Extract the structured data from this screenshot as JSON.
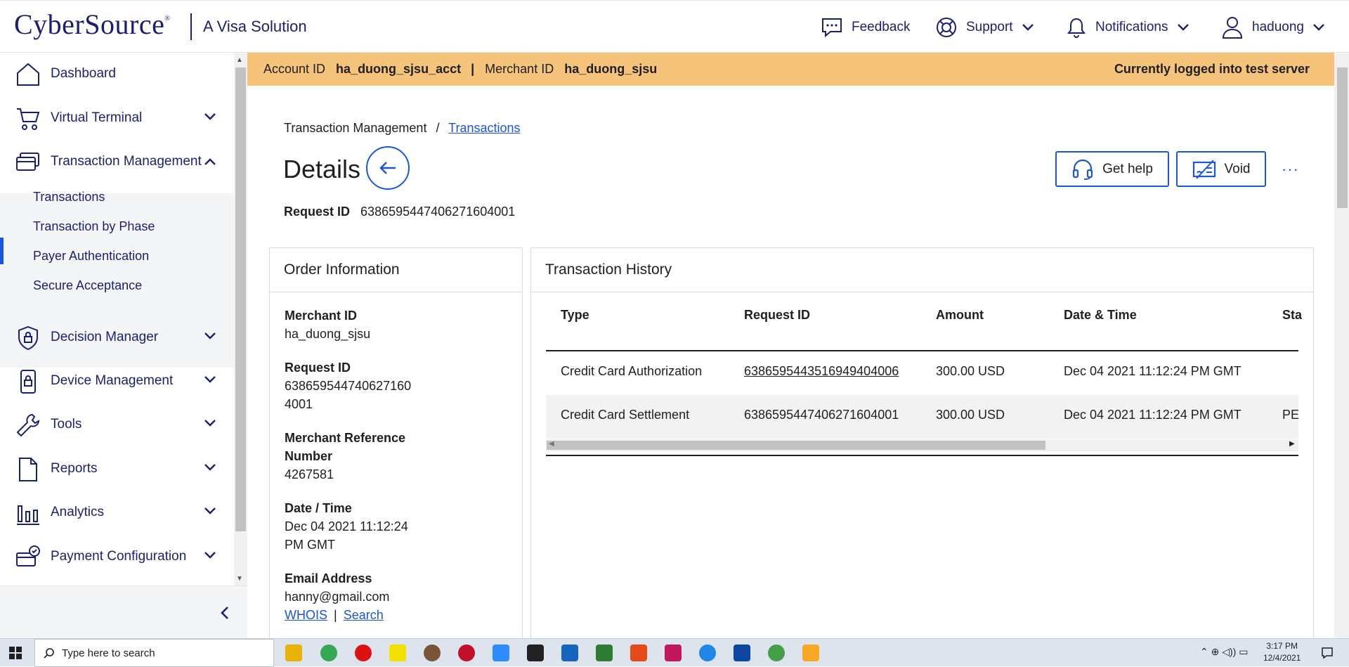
{
  "header": {
    "logo": "CyberSource",
    "logo_mark": "®",
    "logo_sub": "A Visa Solution",
    "feedback": "Feedback",
    "support": "Support",
    "notifications": "Notifications",
    "user": "haduong"
  },
  "sidebar": {
    "items": [
      {
        "label": "Dashboard",
        "icon": "home-icon"
      },
      {
        "label": "Virtual Terminal",
        "icon": "cart-icon"
      },
      {
        "label": "Transaction Management",
        "icon": "cards-icon"
      },
      {
        "label": "Decision Manager",
        "icon": "shield-lock-icon"
      },
      {
        "label": "Device Management",
        "icon": "device-lock-icon"
      },
      {
        "label": "Tools",
        "icon": "wrench-icon"
      },
      {
        "label": "Reports",
        "icon": "document-icon"
      },
      {
        "label": "Analytics",
        "icon": "bar-chart-icon"
      },
      {
        "label": "Payment Configuration",
        "icon": "card-check-icon"
      }
    ],
    "sub_items": [
      "Transactions",
      "Transaction by Phase",
      "Payer Authentication",
      "Secure Acceptance"
    ]
  },
  "banner": {
    "account_label": "Account ID",
    "account_value": "ha_duong_sjsu_acct",
    "divider": "|",
    "merchant_label": "Merchant ID",
    "merchant_value": "ha_duong_sjsu",
    "server_status": "Currently logged into test server"
  },
  "breadcrumb": {
    "parent": "Transaction Management",
    "sep": "/",
    "current": "Transactions"
  },
  "page": {
    "title": "Details",
    "request_label": "Request ID",
    "request_value": "6386595447406271604001",
    "get_help": "Get help",
    "void": "Void",
    "more": "···"
  },
  "order_info": {
    "title": "Order Information",
    "merchant_id_label": "Merchant ID",
    "merchant_id_value": "ha_duong_sjsu",
    "request_id_label": "Request ID",
    "request_id_value_1": "638659544740627160",
    "request_id_value_2": "4001",
    "ref_label_1": "Merchant Reference",
    "ref_label_2": "Number",
    "ref_value": "4267581",
    "date_label": "Date / Time",
    "date_value_1": "Dec 04 2021 11:12:24",
    "date_value_2": "PM GMT",
    "email_label": "Email Address",
    "email_value": "hanny@gmail.com",
    "whois": "WHOIS",
    "pipe": "|",
    "search": "Search"
  },
  "history": {
    "title": "Transaction History",
    "columns": [
      "Type",
      "Request ID",
      "Amount",
      "Date & Time",
      "Sta"
    ],
    "rows": [
      {
        "type": "Credit Card Authorization",
        "request_id": "6386595443516949404006",
        "amount": "300.00 USD",
        "datetime": "Dec 04 2021 11:12:24 PM GMT",
        "status": ""
      },
      {
        "type": "Credit Card Settlement",
        "request_id": "6386595447406271604001",
        "amount": "300.00 USD",
        "datetime": "Dec 04 2021 11:12:24 PM GMT",
        "status": "PE"
      }
    ]
  },
  "taskbar": {
    "search_placeholder": "Type here to search",
    "time": "3:17 PM",
    "date": "12/4/2021"
  },
  "colors": {
    "brand_navy": "#1a1f71",
    "accent_blue": "#1a56db",
    "banner": "#f6c37a"
  }
}
